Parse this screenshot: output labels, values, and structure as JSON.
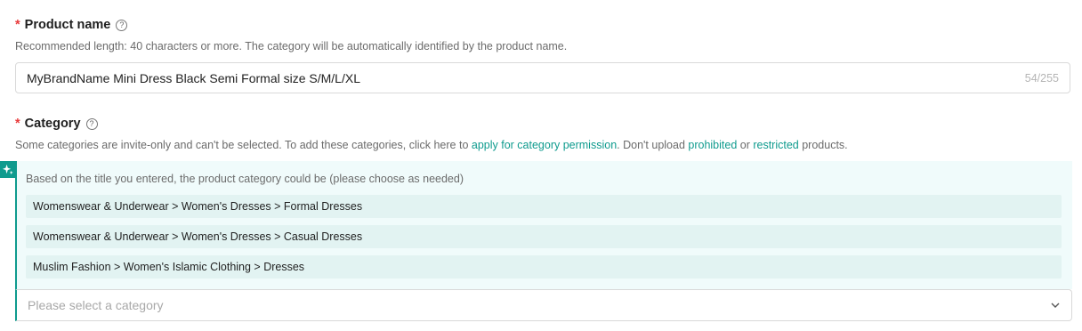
{
  "product_name": {
    "required_mark": "*",
    "label": "Product name",
    "help_glyph": "?",
    "hint": "Recommended length: 40 characters or more. The category will be automatically identified by the product name.",
    "value": "MyBrandName Mini Dress Black Semi Formal size S/M/L/XL",
    "counter": "54/255"
  },
  "category": {
    "required_mark": "*",
    "label": "Category",
    "help_glyph": "?",
    "hint_pre": "Some categories are invite-only and can't be selected. To add these categories, click here to ",
    "hint_link_permission": "apply for category permission",
    "hint_mid": ". Don't upload ",
    "hint_link_prohibited": "prohibited",
    "hint_or": " or ",
    "hint_link_restricted": "restricted",
    "hint_post": " products.",
    "suggestion_title": "Based on the title you entered, the product category could be (please choose as needed)",
    "suggestions": [
      "Womenswear & Underwear > Women's Dresses > Formal Dresses",
      "Womenswear & Underwear > Women's Dresses > Casual Dresses",
      "Muslim Fashion > Women's Islamic Clothing > Dresses"
    ],
    "select_placeholder": "Please select a category",
    "ai_icon": "sparkle-icon"
  },
  "colors": {
    "accent": "#0f9b8e",
    "required": "#e8393a",
    "suggest_bg": "#f0fbfb",
    "suggest_item_bg": "#e2f3f2"
  }
}
